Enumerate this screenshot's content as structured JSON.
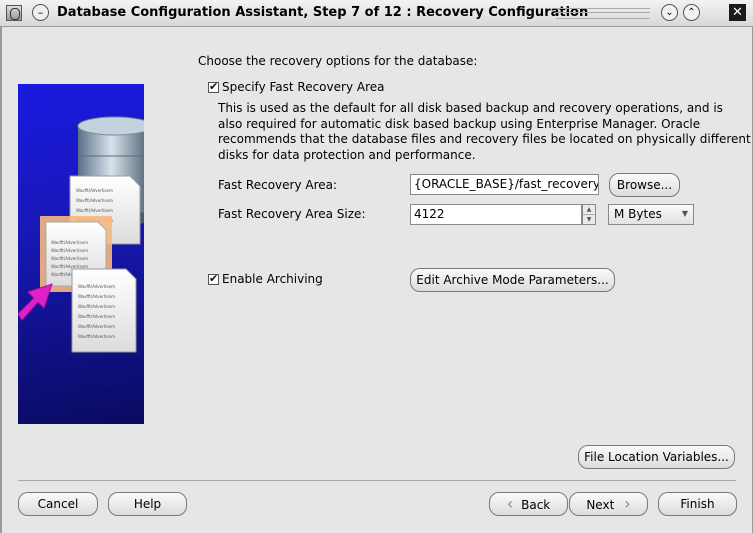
{
  "window": {
    "title": "Database Configuration Assistant, Step 7 of 12 : Recovery Configuration",
    "menu_glyph": "–",
    "minimize_glyph": "⌄",
    "maximize_glyph": "⌃",
    "close_glyph": "✕"
  },
  "main": {
    "heading": "Choose the recovery options for the database:",
    "fast_recovery": {
      "checkbox_label": "Specify Fast Recovery Area",
      "checked": true,
      "description_lines": [
        "This is used as the default for all disk based backup and recovery operations, and is",
        "also required for automatic disk based backup using Enterprise Manager. Oracle",
        "recommends that the database files and recovery files be located on physically different",
        "disks for data protection and performance."
      ],
      "area_label": "Fast Recovery Area:",
      "area_value": "{ORACLE_BASE}/fast_recovery_a",
      "browse_label": "Browse...",
      "size_label": "Fast Recovery Area Size:",
      "size_value": "4122",
      "size_unit": "M Bytes"
    },
    "archiving": {
      "checkbox_label": "Enable Archiving",
      "checked": true,
      "edit_params_label": "Edit Archive Mode Parameters..."
    },
    "file_location_label": "File Location Variables..."
  },
  "footer": {
    "cancel": "Cancel",
    "help": "Help",
    "back": "Back",
    "next": "Next",
    "finish": "Finish",
    "back_chevron": "‹",
    "next_chevron": "›"
  },
  "illustration": {
    "doc_text": "Wavfft/Advertisem"
  },
  "colors": {
    "illustration_bg": "#1a1ae0",
    "arrow": "#e020c8",
    "highlight": "#f0a060"
  }
}
